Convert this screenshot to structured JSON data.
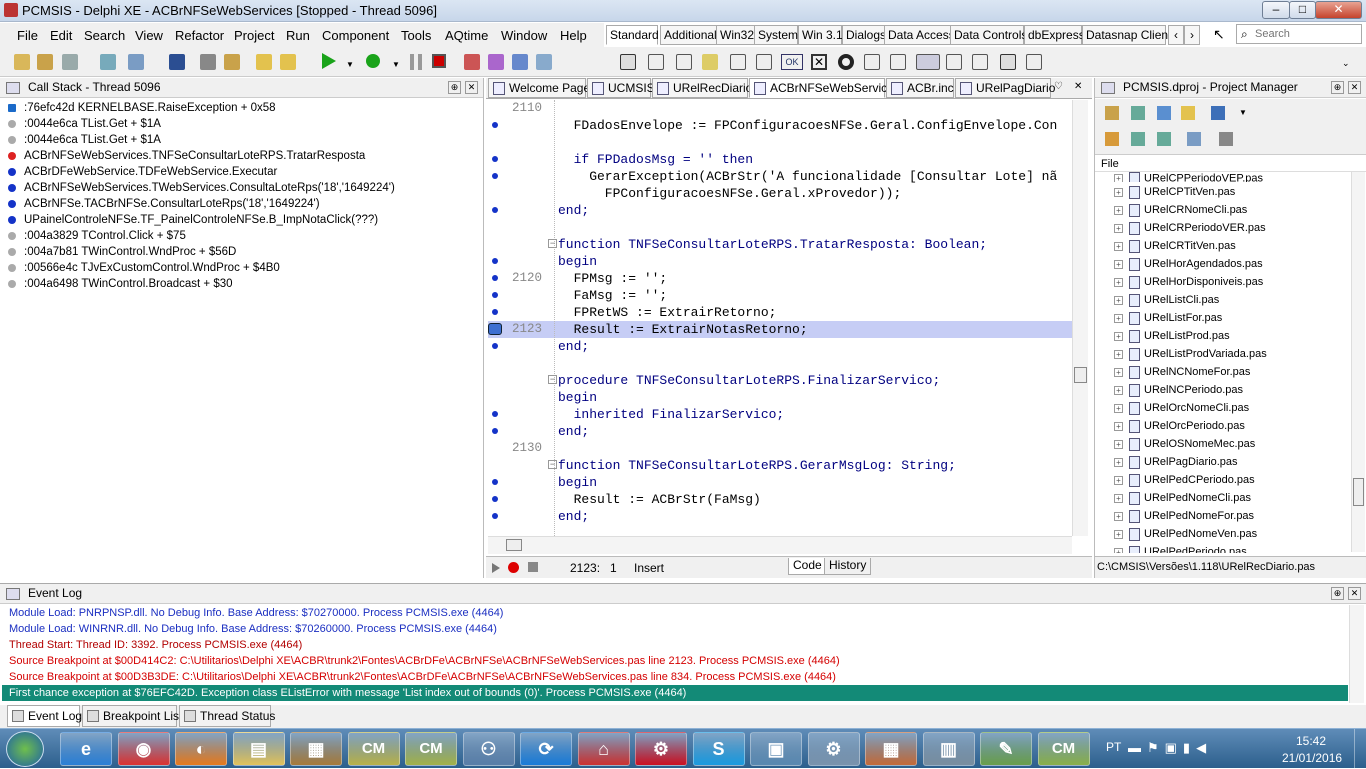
{
  "window": {
    "title": "PCMSIS - Delphi XE - ACBrNFSeWebServices [Stopped - Thread 5096]",
    "minimize": "–",
    "maximize": "□",
    "close": "✕"
  },
  "menu": [
    "File",
    "Edit",
    "Search",
    "View",
    "Refactor",
    "Project",
    "Run",
    "Component",
    "Tools",
    "AQtime",
    "Window",
    "Help"
  ],
  "palette_tabs": [
    "Standard",
    "Additional",
    "Win32",
    "System",
    "Win 3.1",
    "Dialogs",
    "Data Access",
    "Data Controls",
    "dbExpress",
    "Datasnap Client"
  ],
  "palette_active": "Standard",
  "search_placeholder": "Search",
  "call_stack": {
    "title": "Call Stack - Thread 5096",
    "rows": [
      ":76efc42d KERNELBASE.RaiseException + 0x58",
      ":0044e6ca TList.Get + $1A",
      ":0044e6ca TList.Get + $1A",
      "ACBrNFSeWebServices.TNFSeConsultarLoteRPS.TratarResposta",
      "ACBrDFeWebService.TDFeWebService.Executar",
      "ACBrNFSeWebServices.TWebServices.ConsultaLoteRps('18','1649224')",
      "ACBrNFSe.TACBrNFSe.ConsultarLoteRps('18','1649224')",
      "UPainelControleNFSe.TF_PainelControleNFSe.B_ImpNotaClick(???)",
      ":004a3829 TControl.Click + $75",
      ":004a7b81 TWinControl.WndProc + $56D",
      ":00566e4c TJvExCustomControl.WndProc + $4B0",
      ":004a6498 TWinControl.Broadcast + $30"
    ]
  },
  "editor": {
    "tabs": [
      "Welcome Page",
      "UCMSIS",
      "URelRecDiario",
      "ACBrNFSeWebServices",
      "ACBr.inc",
      "URelPagDiario"
    ],
    "active_tab": "ACBrNFSeWebServices",
    "lines": [
      {
        "n": "2110",
        "bp": false,
        "text": ""
      },
      {
        "n": "",
        "bp": true,
        "text": "  FDadosEnvelope := FPConfiguracoesNFSe.Geral.ConfigEnvelope.Con"
      },
      {
        "n": "",
        "bp": false,
        "text": ""
      },
      {
        "n": "",
        "bp": true,
        "text": "  if FPDadosMsg = '' then"
      },
      {
        "n": "",
        "bp": true,
        "text": "    GerarException(ACBrStr('A funcionalidade [Consultar Lote] nã"
      },
      {
        "n": "",
        "bp": false,
        "text": "      FPConfiguracoesNFSe.Geral.xProvedor));"
      },
      {
        "n": "",
        "bp": true,
        "text": "end;"
      },
      {
        "n": "",
        "bp": false,
        "text": ""
      },
      {
        "n": "",
        "bp": false,
        "text": "function TNFSeConsultarLoteRPS.TratarResposta: Boolean;"
      },
      {
        "n": "",
        "bp": true,
        "text": "begin"
      },
      {
        "n": "2120",
        "bp": true,
        "text": "  FPMsg := '';"
      },
      {
        "n": "",
        "bp": true,
        "text": "  FaMsg := '';"
      },
      {
        "n": "",
        "bp": true,
        "text": "  FPRetWS := ExtrairRetorno;"
      },
      {
        "n": "2123",
        "bp": true,
        "text": "  Result := ExtrairNotasRetorno;"
      },
      {
        "n": "",
        "bp": true,
        "text": "end;"
      },
      {
        "n": "",
        "bp": false,
        "text": ""
      },
      {
        "n": "",
        "bp": false,
        "text": "procedure TNFSeConsultarLoteRPS.FinalizarServico;"
      },
      {
        "n": "",
        "bp": false,
        "text": "begin"
      },
      {
        "n": "",
        "bp": true,
        "text": "  inherited FinalizarServico;"
      },
      {
        "n": "",
        "bp": true,
        "text": "end;"
      },
      {
        "n": "2130",
        "bp": false,
        "text": ""
      },
      {
        "n": "",
        "bp": false,
        "text": "function TNFSeConsultarLoteRPS.GerarMsgLog: String;"
      },
      {
        "n": "",
        "bp": true,
        "text": "begin"
      },
      {
        "n": "",
        "bp": true,
        "text": "  Result := ACBrStr(FaMsg)"
      },
      {
        "n": "",
        "bp": true,
        "text": "end;"
      }
    ],
    "status_pos": "2123:   1",
    "status_mode": "Insert",
    "bottom_tabs": [
      "Code",
      "History"
    ]
  },
  "project_manager": {
    "title": "PCMSIS.dproj - Project Manager",
    "column": "File",
    "files": [
      "URelCPPeriodoVEP.pas",
      "URelCPTitVen.pas",
      "URelCRNomeCli.pas",
      "URelCRPeriodoVER.pas",
      "URelCRTitVen.pas",
      "URelHorAgendados.pas",
      "URelHorDisponiveis.pas",
      "URelListCli.pas",
      "URelListFor.pas",
      "URelListProd.pas",
      "URelListProdVariada.pas",
      "URelNCNomeFor.pas",
      "URelNCPeriodo.pas",
      "URelOrcNomeCli.pas",
      "URelOrcPeriodo.pas",
      "URelOSNomeMec.pas",
      "URelPagDiario.pas",
      "URelPedCPeriodo.pas",
      "URelPedNomeCli.pas",
      "URelPedNomeFor.pas",
      "URelPedNomeVen.pas",
      "URelPedPeriodo.pas"
    ],
    "path": "C:\\CMSIS\\Versões\\1.118\\URelRecDiario.pas"
  },
  "event_log": {
    "title": "Event Log",
    "lines": [
      {
        "text": "Module Load: PNRPNSP.dll. No Debug Info. Base Address: $70270000. Process PCMSIS.exe (4464)",
        "color": "#1b2fc1"
      },
      {
        "text": "Module Load: WINRNR.dll. No Debug Info. Base Address: $70260000. Process PCMSIS.exe (4464)",
        "color": "#1b2fc1"
      },
      {
        "text": "Thread Start: Thread ID: 3392. Process PCMSIS.exe (4464)",
        "color": "#b20000"
      },
      {
        "text": "Source Breakpoint at $00D414C2: C:\\Utilitarios\\Delphi XE\\ACBR\\trunk2\\Fontes\\ACBrDFe\\ACBrNFSe\\ACBrNFSeWebServices.pas line 2123. Process PCMSIS.exe (4464)",
        "color": "#d40000"
      },
      {
        "text": "Source Breakpoint at $00D3B3DE: C:\\Utilitarios\\Delphi XE\\ACBR\\trunk2\\Fontes\\ACBrDFe\\ACBrNFSe\\ACBrNFSeWebServices.pas line 834. Process PCMSIS.exe (4464)",
        "color": "#d40000"
      },
      {
        "text": "First chance exception at $76EFC42D. Exception class EListError with message 'List index out of bounds (0)'. Process PCMSIS.exe (4464)",
        "color": "#ffffff"
      }
    ],
    "tabs": [
      "Event Log",
      "Breakpoint List",
      "Thread Status"
    ]
  },
  "taskbar": {
    "apps": [
      "e",
      "◉",
      "◐",
      "▤",
      "▦",
      "CM",
      "CM",
      "⚇",
      "⟳",
      "⌂",
      "⚙",
      "S",
      "▣",
      "⚙",
      "▦",
      "▥",
      "✎",
      "CM"
    ],
    "lang": "PT",
    "time": "15:42",
    "date": "21/01/2016"
  },
  "colors": {
    "current_line": "#c6cdf5",
    "bp_dot": "#1433c8",
    "selected_event": "#138a77",
    "taskbar": "#3a6e9e"
  }
}
